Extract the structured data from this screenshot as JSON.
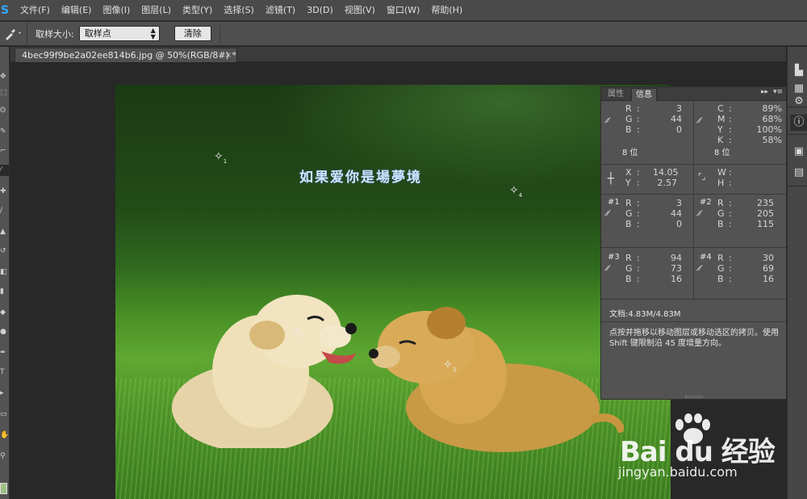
{
  "app": {
    "logo": "S"
  },
  "menu": [
    "文件(F)",
    "编辑(E)",
    "图像(I)",
    "图层(L)",
    "类型(Y)",
    "选择(S)",
    "滤镜(T)",
    "3D(D)",
    "视图(V)",
    "窗口(W)",
    "帮助(H)"
  ],
  "options": {
    "sample_label": "取样大小:",
    "sample_value": "取样点",
    "clear_label": "清除"
  },
  "document": {
    "tab_title": "4bec99f9be2a02ee814b6.jpg @ 50%(RGB/8#) *",
    "close_glyph": "×"
  },
  "image": {
    "overlay_text": "如果爱你是場夢境"
  },
  "markers": [
    "1",
    "4",
    "2",
    "3"
  ],
  "panel": {
    "tabs": [
      "属性",
      "信息"
    ],
    "active_tab": "信息",
    "rgb": {
      "r": "3",
      "g": "44",
      "b": "0",
      "bits": "8 位"
    },
    "cmyk": {
      "c": "89%",
      "m": "68%",
      "y": "100%",
      "k": "58%",
      "bits": "8 位"
    },
    "xy": {
      "x": "14.05",
      "y": "2.57"
    },
    "wh": {
      "w": "",
      "h": ""
    },
    "samplers": [
      {
        "id": "#1",
        "r": "3",
        "g": "44",
        "b": "0"
      },
      {
        "id": "#2",
        "r": "235",
        "g": "205",
        "b": "115"
      },
      {
        "id": "#3",
        "r": "94",
        "g": "73",
        "b": "16"
      },
      {
        "id": "#4",
        "r": "30",
        "g": "69",
        "b": "16"
      }
    ],
    "labels": {
      "r": "R",
      "g": "G",
      "b": "B",
      "c": "C",
      "m": "M",
      "y": "Y",
      "k": "K",
      "x": "X",
      "yy": "Y",
      "w": "W",
      "h": "H"
    },
    "doc_size": "文档:4.83M/4.83M",
    "hint": "点按并拖移以移动图层或移动选区的拷贝。使用 Shift 键限制沿 45 度增量方向。"
  },
  "watermark": {
    "logo": "Bai du 经验",
    "url": "jingyan.baidu.com"
  },
  "colors": {
    "foreground": "#9fbf86",
    "accent": "#31a8ff"
  }
}
